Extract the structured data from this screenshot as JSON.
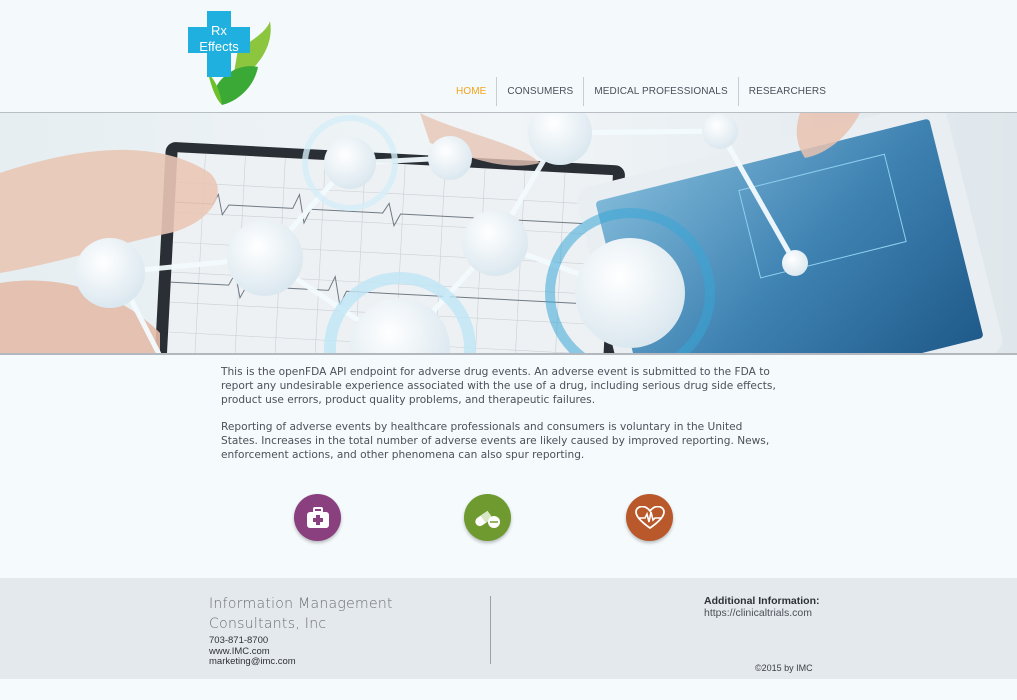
{
  "brand": {
    "logo_line1": "Rx",
    "logo_line2": "Effects"
  },
  "nav": {
    "items": [
      {
        "label": "HOME",
        "active": true
      },
      {
        "label": "CONSUMERS",
        "active": false
      },
      {
        "label": "MEDICAL PROFESSIONALS",
        "active": false
      },
      {
        "label": "RESEARCHERS",
        "active": false
      }
    ]
  },
  "intro": {
    "paragraph1": "This is the openFDA API endpoint for adverse drug events. An adverse event is submitted to the FDA to report any undesirable experience associated with the use of a drug, including serious drug side effects, product use errors, product quality problems, and therapeutic failures.",
    "paragraph2": "Reporting of adverse events by healthcare professionals and consumers is voluntary in the United States. Increases in the total number of adverse events are likely caused by improved reporting. News, enforcement actions, and other phenomena can also spur reporting."
  },
  "features": [
    {
      "icon": "medical-kit-icon",
      "color": "#8a3f7e"
    },
    {
      "icon": "pills-icon",
      "color": "#6e9a2f"
    },
    {
      "icon": "heartbeat-icon",
      "color": "#b9582a"
    }
  ],
  "footer": {
    "company_line1": "Information Management",
    "company_line2": "Consultants, Inc",
    "phone": "703-871-8700",
    "website": "www.IMC.com",
    "email": "marketing@imc.com",
    "additional_title": "Additional Information:",
    "additional_link": "https://clinicaltrials.com",
    "copyright": "©2015 by IMC"
  },
  "colors": {
    "accent": "#f5a31a",
    "logo_blue": "#1fb0e0",
    "logo_green": "#6cc02c"
  }
}
